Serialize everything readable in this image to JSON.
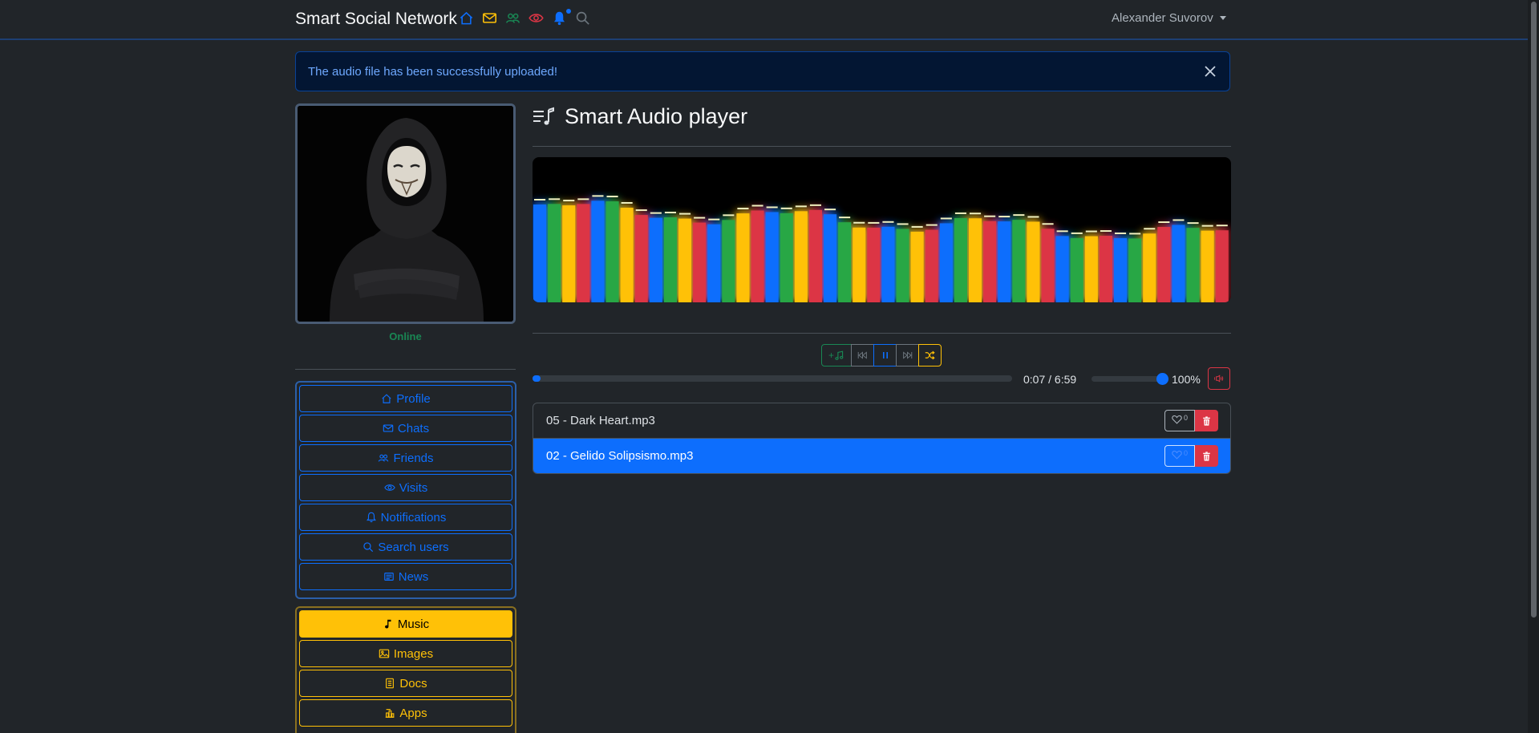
{
  "navbar": {
    "brand": "Smart Social Network",
    "icons": [
      "home-icon",
      "envelope-icon",
      "people-icon",
      "eye-icon",
      "bell-icon",
      "search-icon"
    ],
    "user_name": "Alexander Suvorov"
  },
  "alert": {
    "message": "The audio file has been successfully uploaded!"
  },
  "sidebar": {
    "status": "Online",
    "primary_menu": [
      {
        "label": "Profile",
        "icon": "home-icon"
      },
      {
        "label": "Chats",
        "icon": "envelope-icon"
      },
      {
        "label": "Friends",
        "icon": "people-icon"
      },
      {
        "label": "Visits",
        "icon": "eye-icon"
      },
      {
        "label": "Notifications",
        "icon": "bell-icon"
      },
      {
        "label": "Search users",
        "icon": "search-icon"
      },
      {
        "label": "News",
        "icon": "newspaper-icon"
      }
    ],
    "media_menu": [
      {
        "label": "Music",
        "icon": "music-note-icon",
        "active": true
      },
      {
        "label": "Images",
        "icon": "image-icon"
      },
      {
        "label": "Docs",
        "icon": "document-icon"
      },
      {
        "label": "Apps",
        "icon": "apps-icon"
      }
    ]
  },
  "player": {
    "title": "Smart Audio player",
    "add_label": "+",
    "time": "0:07 / 6:59",
    "progress": 0.017,
    "volume": 1.0,
    "volume_label": "100%",
    "playlist": [
      {
        "name": "05 - Dark Heart.mp3",
        "likes": "0",
        "active": false
      },
      {
        "name": "02 - Gelido Solipsismo.mp3",
        "likes": "0",
        "active": true
      }
    ]
  },
  "colors": {
    "background": "#212529",
    "primary": "#0d6efd",
    "warning": "#ffc107",
    "success": "#198754",
    "danger": "#dc3545",
    "visualizer_bars": [
      "#0d6efd",
      "#28a745",
      "#ffc107",
      "#dc3545"
    ]
  }
}
